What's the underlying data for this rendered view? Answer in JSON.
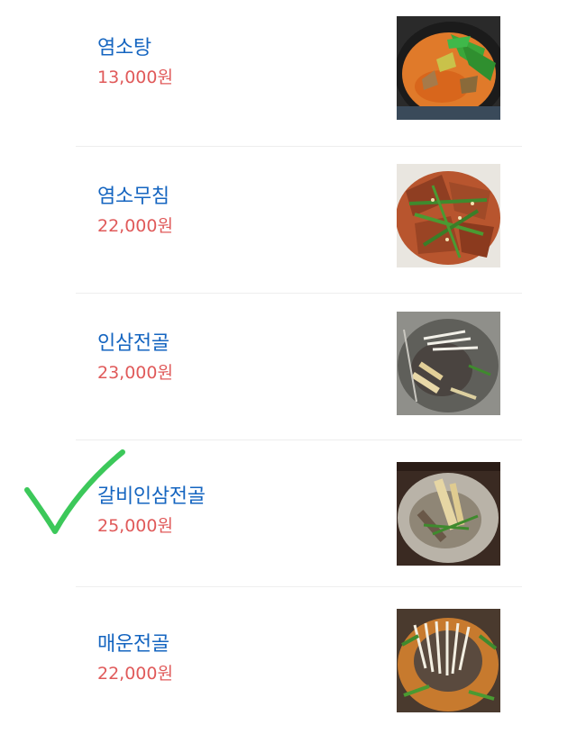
{
  "menu": {
    "items": [
      {
        "name": "염소탕",
        "price": "13,000원",
        "photo_icon": "goat-stew-photo"
      },
      {
        "name": "염소무침",
        "price": "22,000원",
        "photo_icon": "goat-salad-photo"
      },
      {
        "name": "인삼전골",
        "price": "23,000원",
        "photo_icon": "ginseng-hotpot-photo"
      },
      {
        "name": "갈비인삼전골",
        "price": "25,000원",
        "photo_icon": "galbi-ginseng-hotpot-photo"
      },
      {
        "name": "매운전골",
        "price": "22,000원",
        "photo_icon": "spicy-hotpot-photo"
      }
    ]
  },
  "annotation": {
    "mark_icon": "checkmark-icon",
    "mark_color": "#3cc85a"
  },
  "colors": {
    "name": "#1565c0",
    "price": "#e05a5a",
    "divider": "#eeeeee"
  }
}
